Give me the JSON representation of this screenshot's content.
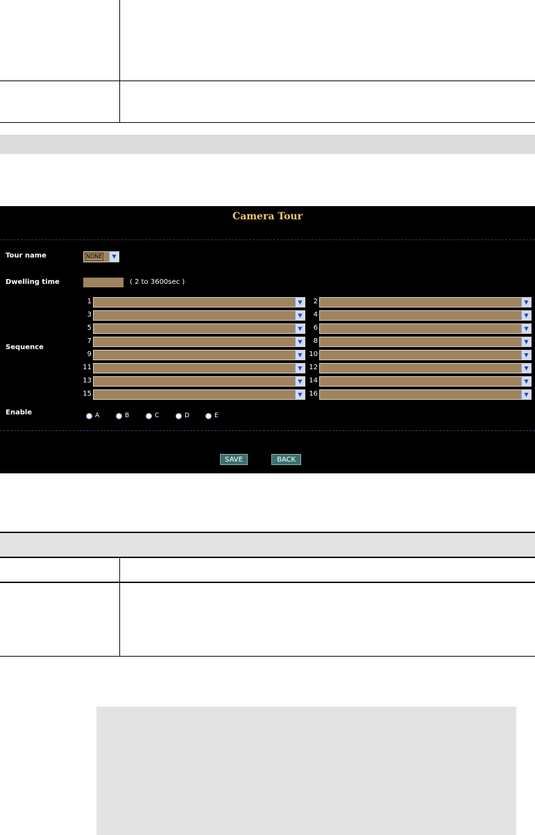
{
  "camera_tour": {
    "title": "Camera Tour",
    "tour_name": {
      "label": "Tour name",
      "selected": "NONE"
    },
    "dwelling_time": {
      "label": "Dwelling time",
      "value": "",
      "note": "( 2 to 3600sec )"
    },
    "sequence": {
      "label": "Sequence",
      "slots": [
        "1",
        "2",
        "3",
        "4",
        "5",
        "6",
        "7",
        "8",
        "9",
        "10",
        "11",
        "12",
        "13",
        "14",
        "15",
        "16"
      ]
    },
    "enable": {
      "label": "Enable",
      "options": [
        "A",
        "B",
        "C",
        "D",
        "E"
      ]
    },
    "buttons": {
      "save": "SAVE",
      "back": "BACK"
    }
  },
  "icons": {
    "dropdown_arrow": "chevron-down-icon",
    "radio": "radio-button"
  },
  "colors": {
    "panel_bg": "#000000",
    "title": "#f0c870",
    "field_bg": "#a08460",
    "button_bg": "#3a7070",
    "grey_band": "#dcdcdc"
  }
}
